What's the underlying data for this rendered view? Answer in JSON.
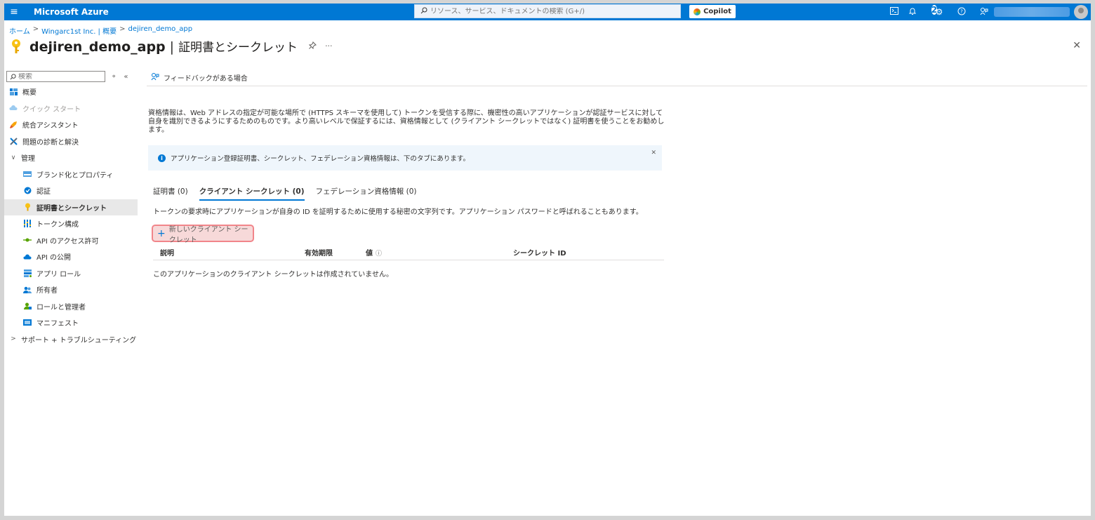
{
  "topbar": {
    "brand": "Microsoft Azure",
    "search_placeholder": "リソース、サービス、ドキュメントの検索 (G+/)",
    "copilot_label": "Copilot",
    "notification_count": "2"
  },
  "breadcrumb": {
    "items": [
      "ホーム",
      "Wingarc1st Inc. | 概要",
      "dejiren_demo_app"
    ],
    "separator": ">"
  },
  "page": {
    "app_name": "dejiren_demo_app",
    "section": "証明書とシークレット",
    "more": "···"
  },
  "sidebar": {
    "search_placeholder": "検索",
    "items": [
      {
        "label": "概要"
      },
      {
        "label": "クイック スタート"
      },
      {
        "label": "統合アシスタント"
      },
      {
        "label": "問題の診断と解決"
      },
      {
        "label": "管理"
      },
      {
        "label": "ブランド化とプロパティ"
      },
      {
        "label": "認証"
      },
      {
        "label": "証明書とシークレット"
      },
      {
        "label": "トークン構成"
      },
      {
        "label": "API のアクセス許可"
      },
      {
        "label": "API の公開"
      },
      {
        "label": "アプリ ロール"
      },
      {
        "label": "所有者"
      },
      {
        "label": "ロールと管理者"
      },
      {
        "label": "マニフェスト"
      },
      {
        "label": "サポート + トラブルシューティング"
      }
    ]
  },
  "main": {
    "feedback_label": "フィードバックがある場合",
    "description": "資格情報は、Web アドレスの指定が可能な場所で (HTTPS スキーマを使用して) トークンを受信する際に、機密性の高いアプリケーションが認証サービスに対して自身を識別できるようにするためのものです。より高いレベルで保証するには、資格情報として (クライアント シークレットではなく) 証明書を使うことをお勧めします。",
    "info_banner": "アプリケーション登録証明書、シークレット、フェデレーション資格情報は、下のタブにあります。",
    "tabs": [
      {
        "label": "証明書 (0)"
      },
      {
        "label": "クライアント シークレット (0)"
      },
      {
        "label": "フェデレーション資格情報 (0)"
      }
    ],
    "tab_description": "トークンの要求時にアプリケーションが自身の ID を証明するために使用する秘密の文字列です。アプリケーション パスワードと呼ばれることもあります。",
    "new_secret_label": "新しいクライアント シークレット",
    "table": {
      "columns": [
        "説明",
        "有効期限",
        "値",
        "シークレット ID"
      ],
      "empty_message": "このアプリケーションのクライアント シークレットは作成されていません。"
    }
  },
  "colors": {
    "azure_blue": "#0078d4",
    "key_yellow": "#f8c215",
    "highlight_border": "#f1858a"
  }
}
